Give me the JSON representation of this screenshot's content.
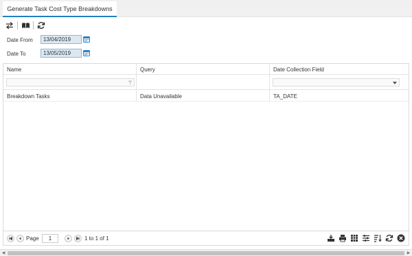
{
  "tab": {
    "title": "Generate Task Cost Type Breakdowns"
  },
  "toolbar": {
    "icons": [
      "swap-arrows-icon",
      "open-book-icon",
      "refresh-icon"
    ]
  },
  "filters": {
    "date_from_label": "Date From",
    "date_from_value": "13/04/2019",
    "date_to_label": "Date To",
    "date_to_value": "13/05/2019"
  },
  "grid": {
    "columns": [
      "Name",
      "Query",
      "Date Collection Field"
    ],
    "rows": [
      [
        "Breakdown Tasks",
        "Data Unavailable",
        "TA_DATE"
      ]
    ]
  },
  "pager": {
    "page_label": "Page",
    "page_value": "1",
    "summary": "1 to 1 of 1"
  },
  "colors": {
    "accent": "#1f7fc0",
    "date_field_bg": "#dbe8f3"
  }
}
